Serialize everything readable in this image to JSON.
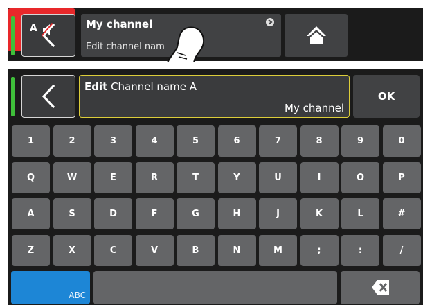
{
  "top_bar": {
    "channel_title": "My channel",
    "channel_subtitle": "Edit channel nam",
    "mute_label": "A"
  },
  "edit_bar": {
    "edit_word": "Edit",
    "field_name": "Channel name A",
    "value": "My channel",
    "ok_label": "OK"
  },
  "keyboard": {
    "rows": [
      [
        "1",
        "2",
        "3",
        "4",
        "5",
        "6",
        "7",
        "8",
        "9",
        "0"
      ],
      [
        "Q",
        "W",
        "E",
        "R",
        "T",
        "Y",
        "U",
        "I",
        "O",
        "P"
      ],
      [
        "A",
        "S",
        "D",
        "F",
        "G",
        "H",
        "J",
        "K",
        "L",
        "#"
      ],
      [
        "Z",
        "X",
        "C",
        "V",
        "B",
        "N",
        "M",
        ";",
        ":",
        "/"
      ]
    ],
    "mode_label": "ABC"
  },
  "icons": {
    "back": "chevron-left-icon",
    "info": "info-icon",
    "home": "home-icon",
    "mute": "speaker-muted-icon",
    "backspace": "backspace-icon",
    "finger": "tap-finger-icon"
  },
  "colors": {
    "status_green": "#3fbf3a",
    "mute_red": "#e8282a",
    "edit_border": "#dccd3a",
    "mode_blue": "#1d86d6"
  }
}
